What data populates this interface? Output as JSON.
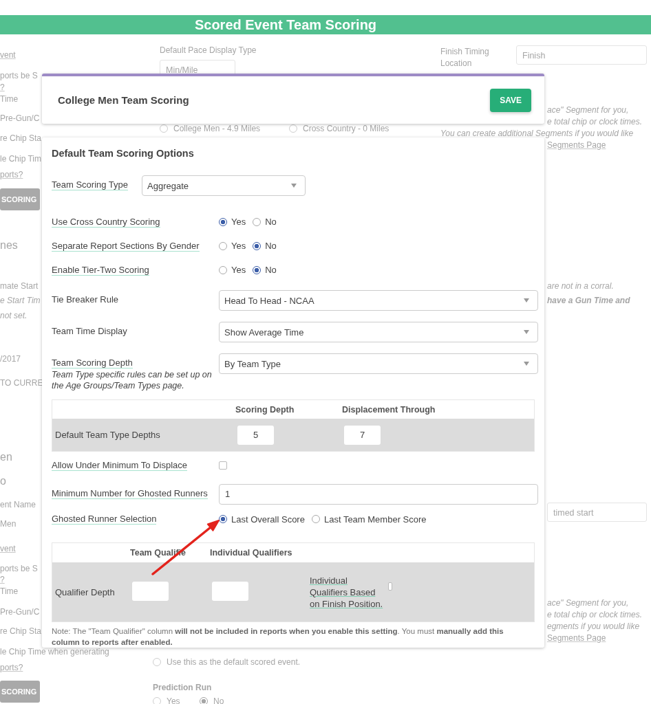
{
  "header": {
    "title": "Scored Event Team Scoring"
  },
  "background": [
    {
      "items": [
        {
          "kind": "link",
          "text": "vent"
        },
        {
          "kind": "text",
          "text": "ports be S"
        },
        {
          "kind": "link",
          "text": "?"
        },
        {
          "kind": "text",
          "text": "Time"
        },
        {
          "kind": "text",
          "text": "Pre-Gun/C"
        },
        {
          "kind": "text",
          "text": "re Chip Sta"
        },
        {
          "kind": "text",
          "text": "le Chip Tim"
        },
        {
          "kind": "link",
          "text": "ports?"
        },
        {
          "kind": "button",
          "text": "SCORING"
        },
        {
          "kind": "heading",
          "text": "nes"
        },
        {
          "kind": "text",
          "text": "mate Start"
        },
        {
          "kind": "italic",
          "text": "e Start Tim"
        },
        {
          "kind": "italic",
          "text": "not set."
        },
        {
          "kind": "text",
          "text": "/2017"
        },
        {
          "kind": "text",
          "text": "TO CURRE"
        },
        {
          "kind": "heading",
          "text": "en"
        },
        {
          "kind": "heading",
          "text": "o"
        },
        {
          "kind": "text",
          "text": "ent Name"
        },
        {
          "kind": "text",
          "text": "Men"
        },
        {
          "kind": "link",
          "text": "vent"
        },
        {
          "kind": "text",
          "text": "ports be S"
        },
        {
          "kind": "link",
          "text": "?"
        },
        {
          "kind": "text",
          "text": "Time"
        },
        {
          "kind": "text",
          "text": "Pre-Gun/C"
        },
        {
          "kind": "text",
          "text": "re Chip Sta"
        },
        {
          "kind": "text",
          "text": "le Chip Time when generating"
        },
        {
          "kind": "link",
          "text": "ports?"
        },
        {
          "kind": "button",
          "text": "SCORING"
        }
      ]
    },
    {
      "items": [
        {
          "kind": "text",
          "text": "Default Pace Display Type"
        },
        {
          "kind": "dropdown",
          "text": "Min/Mile"
        },
        {
          "kind": "radio",
          "text": "College Men - 4.9 Miles",
          "selected": false
        }
      ]
    },
    {
      "items": [
        {
          "kind": "radio",
          "text": "Cross Country - 0 Miles",
          "selected": false
        }
      ]
    },
    {
      "items": [
        {
          "kind": "text",
          "text": "Finish Timing"
        },
        {
          "kind": "text",
          "text": "Location"
        },
        {
          "kind": "italic",
          "text": "You can create additional Segments if you would like"
        }
      ]
    },
    {
      "items": [
        {
          "kind": "dropdown",
          "text": "Finish"
        }
      ]
    },
    {
      "items": [
        {
          "kind": "italic",
          "text": "ace\" Segment for you,"
        },
        {
          "kind": "italic",
          "text": "e total chip or clock times."
        },
        {
          "kind": "link",
          "text": "Segments Page"
        },
        {
          "kind": "italic",
          "text": "are not in a corral."
        },
        {
          "kind": "bold_italic",
          "text": "have a Gun Time and"
        },
        {
          "kind": "dropdown",
          "text": "timed start"
        },
        {
          "kind": "italic",
          "text": "ace\" Segment for you,"
        },
        {
          "kind": "italic",
          "text": "e total chip or clock times."
        },
        {
          "kind": "italic",
          "text": "egments if you would like"
        },
        {
          "kind": "link",
          "text": "Segments Page"
        }
      ]
    },
    {
      "items": [
        {
          "kind": "radio",
          "text": "Use this as the default scored event.",
          "selected": false
        },
        {
          "kind": "bold",
          "text": "Prediction Run"
        },
        {
          "kind": "radio",
          "text": "Yes",
          "selected": false
        }
      ]
    },
    {
      "items": [
        {
          "kind": "radio",
          "text": "No",
          "selected": true
        }
      ]
    }
  ],
  "modal": {
    "title": "College Men Team Scoring",
    "save_button": "SAVE",
    "section_title": "Default Team Scoring Options",
    "fields": [
      {
        "kind": "short_select",
        "label": "Team Scoring Type",
        "has_help": true,
        "value": "Aggregate"
      },
      {
        "kind": "radio",
        "label": "Use Cross Country Scoring",
        "has_help": true,
        "options": [
          {
            "label": "Yes",
            "selected": true
          },
          {
            "label": "No",
            "selected": false
          }
        ]
      },
      {
        "kind": "radio",
        "label": "Separate Report Sections By Gender",
        "has_help": true,
        "options": [
          {
            "label": "Yes",
            "selected": false
          },
          {
            "label": "No",
            "selected": true
          }
        ]
      },
      {
        "kind": "radio",
        "label": "Enable Tier-Two Scoring",
        "has_help": true,
        "options": [
          {
            "label": "Yes",
            "selected": false
          },
          {
            "label": "No",
            "selected": true
          }
        ]
      },
      {
        "kind": "select",
        "label": "Tie Breaker Rule",
        "has_help": false,
        "value": "Head To Head - NCAA"
      },
      {
        "kind": "select",
        "label": "Team Time Display",
        "has_help": false,
        "value": "Show Average Time"
      },
      {
        "kind": "select",
        "label": "Team Scoring Depth",
        "has_help": true,
        "note": "Team Type specific rules can be set up on the Age Groups/Team Types page.",
        "value": "By Team Type"
      }
    ],
    "depth_table": {
      "columns": [
        "Scoring Depth",
        "Displacement Through"
      ],
      "row_label": "Default Team Type Depths",
      "values": [
        "5",
        "7"
      ]
    },
    "fields_2": [
      {
        "kind": "checkbox",
        "label": "Allow Under Minimum To Displace",
        "has_help": true,
        "checked": false
      },
      {
        "kind": "input",
        "label": "Minimum Number for Ghosted Runners",
        "has_help": true,
        "value": "1"
      },
      {
        "kind": "radio",
        "label": "Ghosted Runner Selection",
        "has_help": true,
        "options": [
          {
            "label": "Last Overall Score",
            "selected": true
          },
          {
            "label": "Last Team Member Score",
            "selected": false
          }
        ]
      }
    ],
    "qualifier_table": {
      "columns": [
        "Team Qualifie",
        "Individual Qualifiers"
      ],
      "row_label": "Qualifier Depth",
      "option": {
        "label": "Individual Qualifiers Based on Finish Position.",
        "has_help": true,
        "checked": false
      }
    },
    "note": "Note: The \"Team Qualifier\" column **will not be included in reports when you enable this setting**. You must **manually add this column to reports after enabled.**"
  }
}
